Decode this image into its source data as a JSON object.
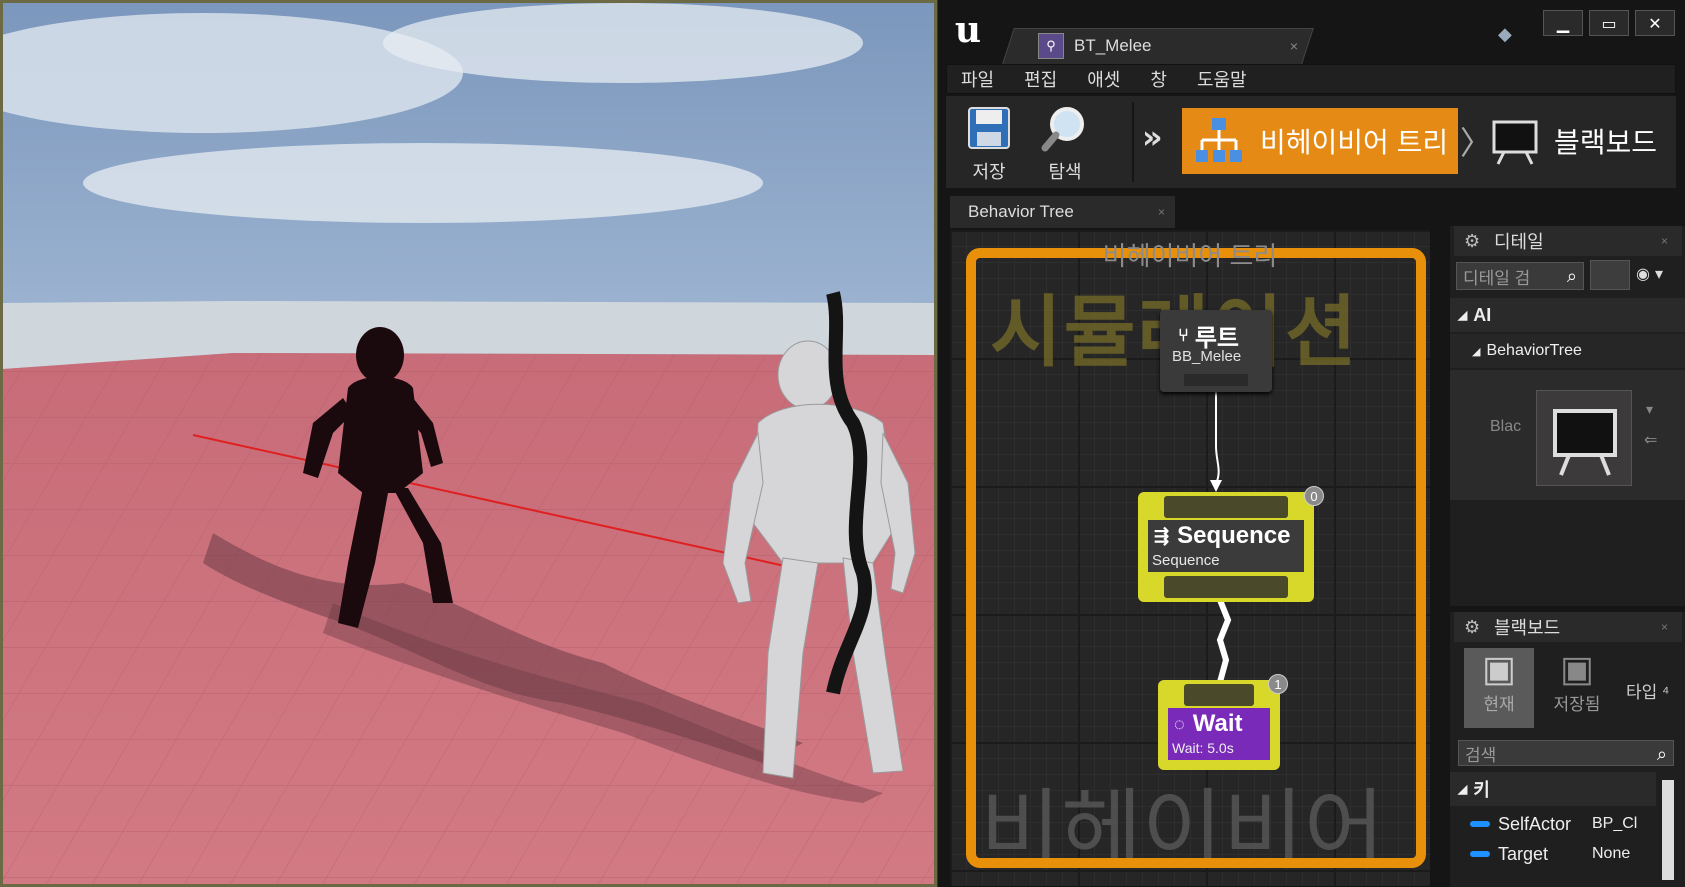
{
  "editor": {
    "doc_tab_title": "BT_Melee",
    "window_controls": [
      "▁",
      "▭",
      "✕"
    ]
  },
  "menu": [
    "파일",
    "편집",
    "애셋",
    "창",
    "도움말"
  ],
  "toolbar": {
    "save_label": "저장",
    "browse_label": "탐색",
    "mode_behavior_tree": "비헤이비어 트리",
    "mode_blackboard": "블랙보드"
  },
  "graph": {
    "tab_title": "Behavior Tree",
    "panel_title": "비헤이비어 트리",
    "watermark_top": "시뮬레이션",
    "watermark_bottom": "비헤이비어",
    "nodes": {
      "root": {
        "title": "루트",
        "subtitle": "BB_Melee"
      },
      "sequence": {
        "title": "Sequence",
        "subtitle": "Sequence",
        "index": "0"
      },
      "wait": {
        "title": "Wait",
        "subtitle": "Wait: 5.0s",
        "index": "1"
      }
    }
  },
  "details": {
    "tab_title": "디테일",
    "search_placeholder": "디테일 검",
    "category_ai": "AI",
    "category_behavior_tree": "BehaviorTree",
    "property_label": "Blac"
  },
  "blackboard": {
    "tab_title": "블랙보드",
    "current_label": "현재",
    "saved_label": "저장됨",
    "type_label": "타입 ⁴",
    "search_placeholder": "검색",
    "keys_header": "키",
    "keys": [
      {
        "name": "SelfActor",
        "value": "BP_Cl"
      },
      {
        "name": "Target",
        "value": "None"
      }
    ]
  },
  "colors": {
    "accent_orange": "#e58a14",
    "node_yellow": "#d8d82a",
    "wait_purple": "#7a2ab8",
    "floor_pink": "#c56a78"
  }
}
